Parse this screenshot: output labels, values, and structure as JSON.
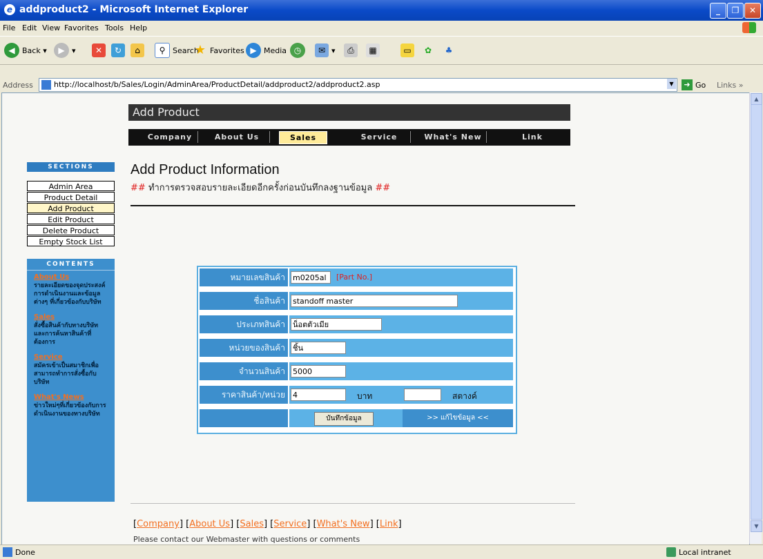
{
  "window": {
    "title": "addproduct2 - Microsoft Internet Explorer"
  },
  "menu": [
    "File",
    "Edit",
    "View",
    "Favorites",
    "Tools",
    "Help"
  ],
  "toolbar": {
    "back": "Back",
    "search": "Search",
    "favorites": "Favorites",
    "media": "Media"
  },
  "address": {
    "label": "Address",
    "url": "http://localhost/b/Sales/Login/AdminArea/ProductDetail/addproduct2/addproduct2.asp",
    "go": "Go",
    "links": "Links"
  },
  "page": {
    "header": "Add Product",
    "nav": [
      "Company",
      "About Us",
      "Sales",
      "Service",
      "What's New",
      "Link"
    ],
    "nav_active": "Sales",
    "title": "Add Product Information",
    "subtitle_hash": "##",
    "subtitle_text": "ทำการตรวจสอบรายละเอียดอีกครั้งก่อนบันทึกลงฐานข้อมูล"
  },
  "sidebar": {
    "sections_label": "SECTIONS",
    "items": [
      "Admin Area",
      "Product Detail",
      "Add Product",
      "Edit Product",
      "Delete Product",
      "Empty Stock List"
    ],
    "active": "Add Product",
    "contents_label": "CONTENTS",
    "contents": [
      {
        "link": "About Us",
        "desc": "รายละเอียดของจุดประสงค์การดำเนินงานและข้อมูลต่างๆ ที่เกี่ยวข้องกับบริษัท"
      },
      {
        "link": "Sales",
        "desc": "สั่งซื้อสินค้ากับทางบริษัทและการค้นหาสินค้าที่ต้องการ"
      },
      {
        "link": "Service",
        "desc": "สมัครเข้าเป็นสมาชิกเพื่อสามารถทำการสั่งซื้อกับบริษัท"
      },
      {
        "link": "What's News",
        "desc": "ข่าวใหม่ๆที่เกี่ยวข้องกับการดำเนินงานของทางบริษัท"
      }
    ]
  },
  "form": {
    "rows": [
      {
        "label": "หมายเลขสินค้า",
        "value": "m0205al",
        "hint": "[Part No.]"
      },
      {
        "label": "ชื่อสินค้า",
        "value": "standoff master"
      },
      {
        "label": "ประเภทสินค้า",
        "value": "น็อตตัวเมีย"
      },
      {
        "label": "หน่วยของสินค้า",
        "value": "ชิ้น"
      },
      {
        "label": "จำนวนสินค้า",
        "value": "5000"
      },
      {
        "label": "ราคาสินค้า/หน่วย",
        "value": "4",
        "unit_baht": "บาท",
        "satang_value": "",
        "unit_satang": "สตางค์"
      }
    ],
    "save_button": "บันทึกข้อมูล",
    "edit_link": ">> แก้ไขข้อมูล <<"
  },
  "footer": {
    "links": [
      "Company",
      "About Us",
      "Sales",
      "Service",
      "What's New",
      "Link"
    ],
    "contact_text": "Please contact our Webmaster with questions or comments"
  },
  "status": {
    "left": "Done",
    "zone": "Local intranet"
  }
}
